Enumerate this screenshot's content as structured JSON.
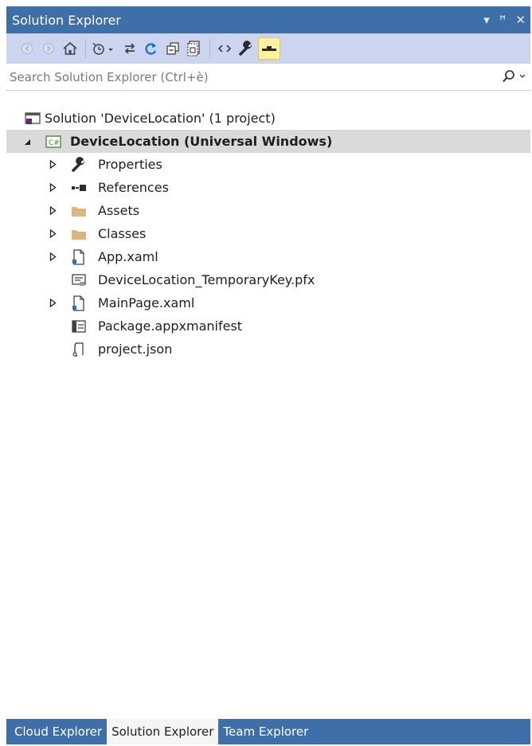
{
  "window": {
    "title": "Solution Explorer",
    "controls": [
      "▾",
      "ꟸ",
      "✕"
    ]
  },
  "toolbar": {
    "buttons": [
      "back-icon",
      "forward-icon",
      "home-icon",
      "history-icon",
      "sync-icon",
      "refresh-icon",
      "collapse-all-icon",
      "show-all-files-icon",
      "view-code-icon",
      "properties-icon",
      "preview-icon"
    ]
  },
  "search": {
    "placeholder": "Search Solution Explorer (Ctrl+è)"
  },
  "tree": {
    "solution": {
      "label": "Solution 'DeviceLocation' (1 project)"
    },
    "project": {
      "label": "DeviceLocation (Universal Windows)"
    },
    "items": [
      {
        "label": "Properties",
        "icon": "wrench-icon",
        "expandable": true
      },
      {
        "label": "References",
        "icon": "references-icon",
        "expandable": true
      },
      {
        "label": "Assets",
        "icon": "folder-icon",
        "expandable": true
      },
      {
        "label": "Classes",
        "icon": "folder-icon",
        "expandable": true
      },
      {
        "label": "App.xaml",
        "icon": "xaml-file-icon",
        "expandable": true
      },
      {
        "label": "DeviceLocation_TemporaryKey.pfx",
        "icon": "certificate-icon",
        "expandable": false
      },
      {
        "label": "MainPage.xaml",
        "icon": "xaml-file-icon",
        "expandable": true
      },
      {
        "label": "Package.appxmanifest",
        "icon": "manifest-icon",
        "expandable": false
      },
      {
        "label": "project.json",
        "icon": "json-file-icon",
        "expandable": false
      }
    ]
  },
  "bottom_tabs": [
    {
      "label": "Cloud Explorer",
      "active": false
    },
    {
      "label": "Solution Explorer",
      "active": true
    },
    {
      "label": "Team Explorer",
      "active": false
    }
  ],
  "colors": {
    "titlebar": "#3e6fa8",
    "toolbar": "#ccd5f0",
    "selected_row": "#dadada",
    "folder": "#dcb67a",
    "active_tool": "#fff29d"
  }
}
